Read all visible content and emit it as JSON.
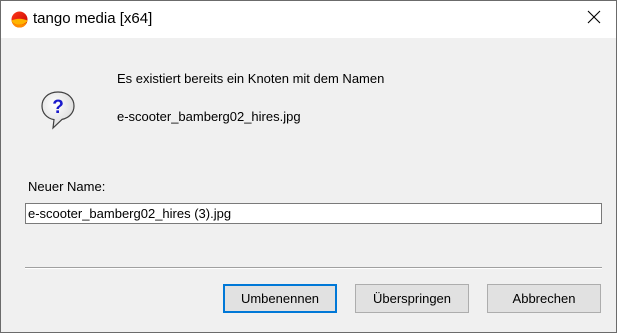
{
  "window": {
    "title": "tango media [x64]",
    "app_icon": "tango-media-logo-icon",
    "close_icon": "close-icon"
  },
  "dialog": {
    "icon": "question-icon",
    "message_line1": "Es existiert bereits ein Knoten mit dem Namen",
    "message_line2": "e-scooter_bamberg02_hires.jpg",
    "new_name_label": "Neuer Name:",
    "new_name_value": "e-scooter_bamberg02_hires (3).jpg"
  },
  "buttons": {
    "rename": "Umbenennen",
    "skip": "Überspringen",
    "cancel": "Abbrechen"
  },
  "colors": {
    "default_button_border": "#0078d7",
    "question_icon_blue": "#1a1acc"
  }
}
